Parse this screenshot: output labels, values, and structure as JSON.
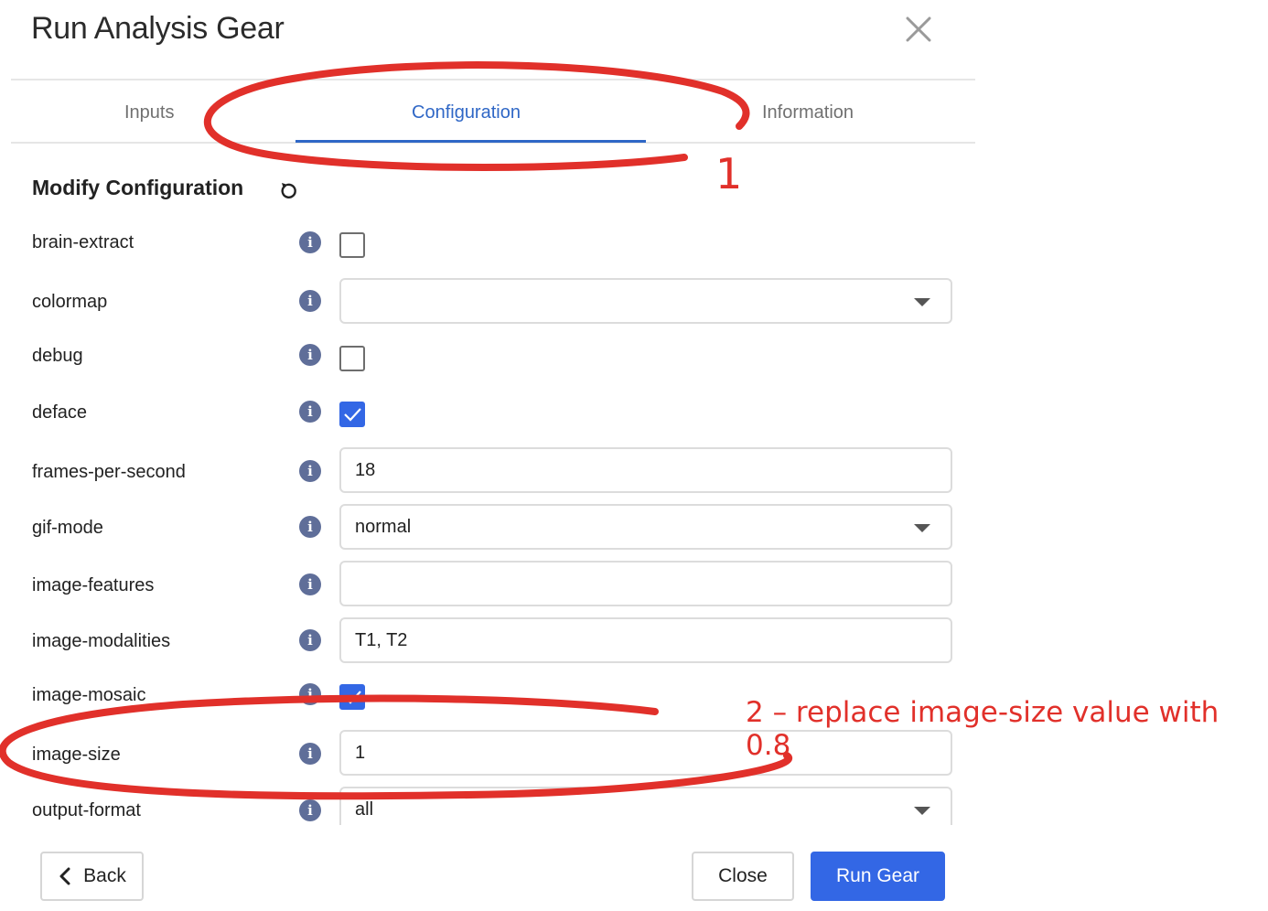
{
  "dialog": {
    "title": "Run Analysis Gear",
    "close_icon": "close-icon"
  },
  "tabs": [
    {
      "label": "Inputs",
      "active": false
    },
    {
      "label": "Configuration",
      "active": true
    },
    {
      "label": "Information",
      "active": false
    }
  ],
  "section": {
    "title": "Modify Configuration",
    "reset_icon": "reset-icon"
  },
  "fields": [
    {
      "label": "brain-extract",
      "type": "checkbox",
      "checked": false
    },
    {
      "label": "colormap",
      "type": "select",
      "value": ""
    },
    {
      "label": "debug",
      "type": "checkbox",
      "checked": false
    },
    {
      "label": "deface",
      "type": "checkbox",
      "checked": true
    },
    {
      "label": "frames-per-second",
      "type": "text",
      "value": "18"
    },
    {
      "label": "gif-mode",
      "type": "select",
      "value": "normal"
    },
    {
      "label": "image-features",
      "type": "text",
      "value": ""
    },
    {
      "label": "image-modalities",
      "type": "text",
      "value": "T1, T2"
    },
    {
      "label": "image-mosaic",
      "type": "checkbox",
      "checked": true
    },
    {
      "label": "image-size",
      "type": "text",
      "value": "1"
    },
    {
      "label": "output-format",
      "type": "select",
      "value": "all"
    }
  ],
  "info_glyph": "i",
  "footer": {
    "back_label": "Back",
    "close_label": "Close",
    "run_label": "Run Gear"
  },
  "annotations": {
    "step1": "1",
    "step2": "2 – replace image-size value with 0.8",
    "color": "#e1302a"
  },
  "colors": {
    "accent": "#2f67c6",
    "primary_button": "#3367e5",
    "info_icon": "#5f6e99"
  }
}
